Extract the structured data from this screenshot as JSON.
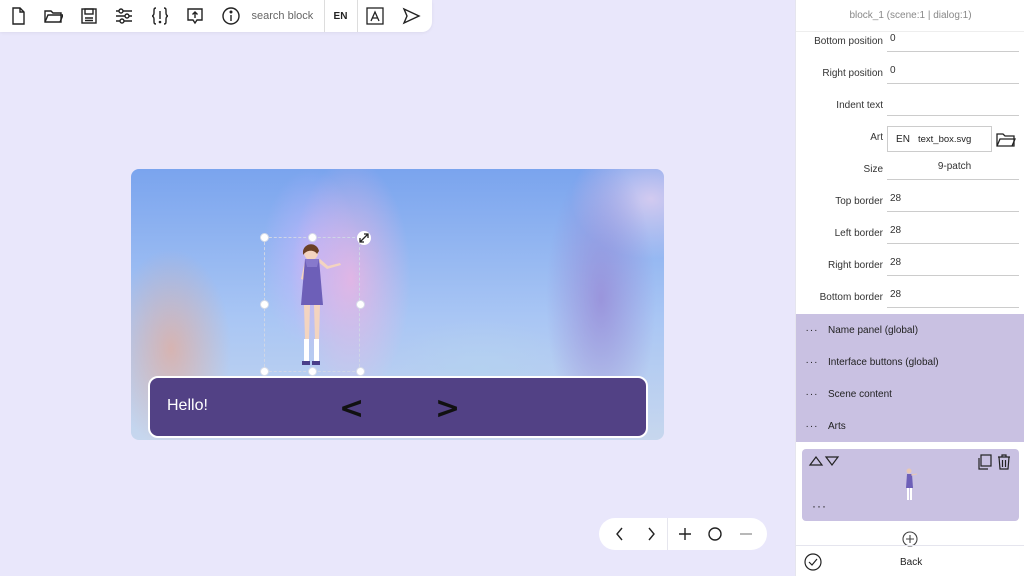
{
  "toolbar": {
    "search_placeholder": "search block",
    "language": "EN",
    "icons": [
      "new-file-icon",
      "open-folder-icon",
      "save-icon",
      "settings-sliders-icon",
      "variables-braces-icon",
      "export-icon",
      "info-icon",
      "translate-icon",
      "play-icon"
    ]
  },
  "stage": {
    "dialog_text": "Hello!",
    "prev_label": "<",
    "next_label": ">"
  },
  "panel": {
    "title": "block_1 (scene:1 | dialog:1)",
    "props": [
      {
        "label": "Bottom position",
        "value": "0"
      },
      {
        "label": "Right position",
        "value": "0"
      },
      {
        "label": "Indent text",
        "value": ""
      },
      {
        "label": "Art",
        "lang": "EN",
        "value": "text_box.svg"
      },
      {
        "label": "Size",
        "value": "9-patch"
      },
      {
        "label": "Top border",
        "value": "28"
      },
      {
        "label": "Left border",
        "value": "28"
      },
      {
        "label": "Right border",
        "value": "28"
      },
      {
        "label": "Bottom border",
        "value": "28"
      }
    ],
    "sections": [
      {
        "dots": "···",
        "label": "Name panel (global)"
      },
      {
        "dots": "···",
        "label": "Interface buttons (global)"
      },
      {
        "dots": "···",
        "label": "Scene content"
      },
      {
        "dots": "···",
        "label": "Arts"
      }
    ],
    "card_dots": "···",
    "back_label": "Back"
  },
  "colors": {
    "background": "#e9e7fb",
    "textbox": "#524185",
    "section": "#c9c1e2"
  }
}
